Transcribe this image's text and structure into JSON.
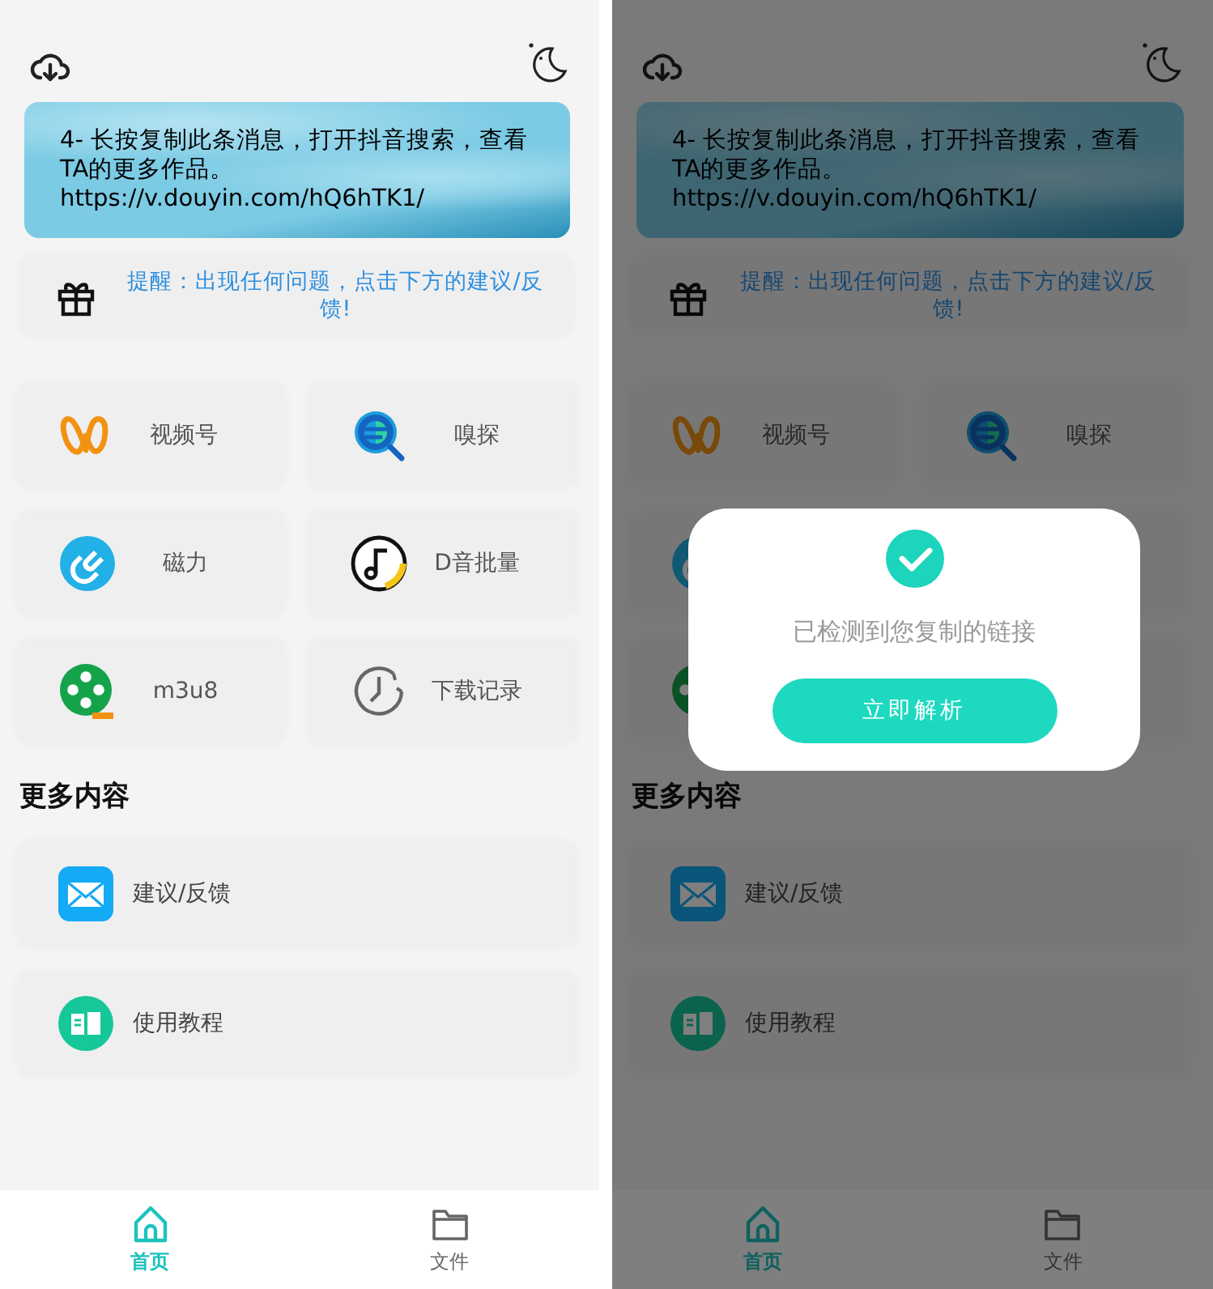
{
  "screens": [
    {
      "banner": {
        "lines": [
          "4- 长按复制此条消息，打开抖音搜索，查看TA的更多作品。",
          "https://v.douyin.com/hQ6hTK1/"
        ]
      },
      "notice": "提醒：出现任何问题，点击下方的建议/反馈!",
      "tools": [
        {
          "kind": "butterfly",
          "label": "视频号"
        },
        {
          "kind": "magnifier",
          "label": "嗅探"
        },
        {
          "kind": "magnet",
          "label": "磁力"
        },
        {
          "kind": "music",
          "label": "D音批量"
        },
        {
          "kind": "reel",
          "label": "m3u8"
        },
        {
          "kind": "clock",
          "label": "下载记录"
        }
      ],
      "section_title": "更多内容",
      "links": [
        {
          "kind": "mail",
          "label": "建议/反馈"
        },
        {
          "kind": "book",
          "label": "使用教程"
        }
      ],
      "tabs": [
        {
          "kind": "home",
          "label": "首页",
          "selected": true
        },
        {
          "kind": "folder",
          "label": "文件",
          "selected": false
        }
      ]
    },
    {
      "banner": {
        "lines": [
          "4- 长按复制此条消息，打开抖音搜索，查看TA的更多作品。",
          "https://v.douyin.com/hQ6hTK1/"
        ]
      },
      "notice": "提醒：出现任何问题，点击下方的建议/反馈!",
      "tools": [
        {
          "kind": "butterfly",
          "label": "视频号"
        },
        {
          "kind": "magnifier",
          "label": "嗅探"
        },
        {
          "kind": "magnet"
        },
        {
          "kind": "covered"
        },
        {
          "kind": "reel"
        },
        {
          "kind": "covered"
        }
      ],
      "section_title": "更多内容",
      "links": [
        {
          "kind": "mail",
          "label": "建议/反馈"
        },
        {
          "kind": "book",
          "label": "使用教程"
        }
      ],
      "tabs": [
        {
          "kind": "home",
          "label": "首页",
          "selected": true
        },
        {
          "kind": "folder",
          "label": "文件",
          "selected": false
        }
      ],
      "dialog": {
        "message": "已检测到您复制的链接",
        "button": "立即解析"
      }
    }
  ]
}
